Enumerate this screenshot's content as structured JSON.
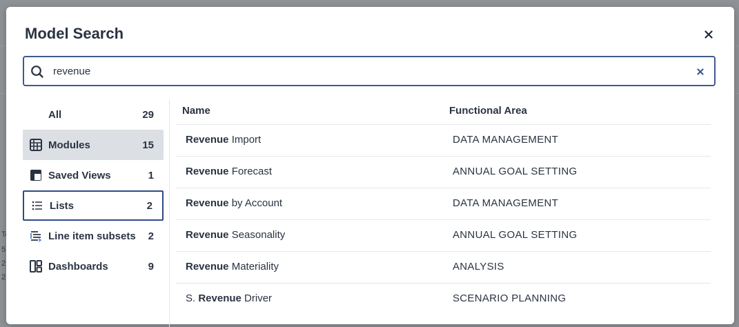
{
  "background": {
    "fragments": [
      "Te",
      "5",
      "2",
      "2"
    ]
  },
  "modal": {
    "title": "Model Search",
    "close_icon": "close-icon"
  },
  "search": {
    "value": "revenue",
    "placeholder": "",
    "search_icon": "search-icon",
    "clear_icon": "clear-icon"
  },
  "sidebar": {
    "items": [
      {
        "label": "All",
        "count": "29",
        "icon": "",
        "state": ""
      },
      {
        "label": "Modules",
        "count": "15",
        "icon": "grid-icon",
        "state": "selected"
      },
      {
        "label": "Saved Views",
        "count": "1",
        "icon": "saved-view-icon",
        "state": ""
      },
      {
        "label": "Lists",
        "count": "2",
        "icon": "list-icon",
        "state": "focused"
      },
      {
        "label": "Line item subsets",
        "count": "2",
        "icon": "line-item-subset-icon",
        "state": ""
      },
      {
        "label": "Dashboards",
        "count": "9",
        "icon": "dashboard-icon",
        "state": ""
      }
    ]
  },
  "results": {
    "columns": [
      "Name",
      "Functional Area"
    ],
    "rows": [
      {
        "prefix": "",
        "match": "Revenue",
        "suffix": " Import",
        "area": "DATA MANAGEMENT"
      },
      {
        "prefix": "",
        "match": "Revenue",
        "suffix": " Forecast",
        "area": "ANNUAL GOAL SETTING"
      },
      {
        "prefix": "",
        "match": "Revenue",
        "suffix": " by Account",
        "area": "DATA MANAGEMENT"
      },
      {
        "prefix": "",
        "match": "Revenue",
        "suffix": " Seasonality",
        "area": "ANNUAL GOAL SETTING"
      },
      {
        "prefix": "",
        "match": "Revenue",
        "suffix": " Materiality",
        "area": "ANALYSIS"
      },
      {
        "prefix": "S. ",
        "match": "Revenue",
        "suffix": " Driver",
        "area": "SCENARIO PLANNING"
      }
    ]
  },
  "colors": {
    "accent_border": "#3e5a8a",
    "selected_bg": "#dcdfe4",
    "text": "#2a3342"
  }
}
